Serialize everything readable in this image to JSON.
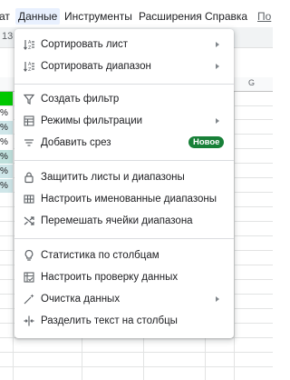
{
  "menubar": {
    "items": [
      {
        "label": "ат"
      },
      {
        "label": "Данные"
      },
      {
        "label": "Инструменты"
      },
      {
        "label": "Расширения"
      },
      {
        "label": "Справка"
      },
      {
        "label": "По"
      }
    ]
  },
  "sheet": {
    "toolbar_fragment": "13",
    "column_g": "G",
    "pct_cells": [
      "%",
      "%",
      "%",
      "%",
      "%",
      "%"
    ]
  },
  "menu": {
    "items": [
      {
        "icon": "sort-icon",
        "label": "Сортировать лист",
        "submenu": true
      },
      {
        "icon": "sort-range-icon",
        "label": "Сортировать диапазон",
        "submenu": true
      },
      {
        "icon": "filter-icon",
        "label": "Создать фильтр"
      },
      {
        "icon": "filter-views-icon",
        "label": "Режимы фильтрации",
        "submenu": true
      },
      {
        "icon": "slicer-icon",
        "label": "Добавить срез",
        "badge": "Новое"
      },
      {
        "icon": "lock-icon",
        "label": "Защитить листы и диапазоны"
      },
      {
        "icon": "named-ranges-icon",
        "label": "Настроить именованные диапазоны"
      },
      {
        "icon": "shuffle-icon",
        "label": "Перемешать ячейки диапазона"
      },
      {
        "icon": "lightbulb-icon",
        "label": "Статистика по столбцам"
      },
      {
        "icon": "data-validation-icon",
        "label": "Настроить проверку данных"
      },
      {
        "icon": "cleanup-icon",
        "label": "Очистка данных",
        "submenu": true
      },
      {
        "icon": "split-text-icon",
        "label": "Разделить текст на столбцы"
      }
    ]
  },
  "colors": {
    "badge": "#188038",
    "active_menu_bg": "#e8f0fe",
    "green_cell": "#00c800"
  }
}
